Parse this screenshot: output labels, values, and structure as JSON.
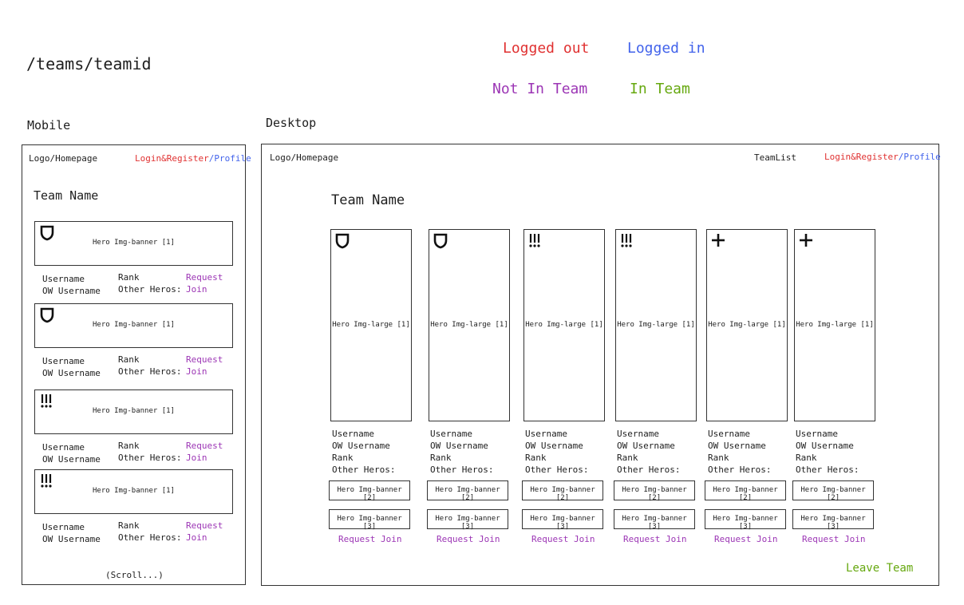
{
  "route": "/teams/teamid",
  "legend": {
    "logged_out": "Logged out",
    "logged_in": "Logged in",
    "not_in_team": "Not In Team",
    "in_team": "In Team"
  },
  "colors": {
    "logged_out": "#e03131",
    "logged_in": "#4263eb",
    "not_in_team": "#9c36b5",
    "in_team": "#66a80f"
  },
  "mobile": {
    "label": "Mobile",
    "logo": "Logo/Homepage",
    "login": "Login&Register",
    "profile": "/Profile",
    "team_name": "Team Name",
    "scroll": "(Scroll...)",
    "members": [
      {
        "icon": "shield-icon",
        "banner": "Hero Img-banner [1]",
        "username": "Username",
        "ow_username": "OW Username",
        "rank": "Rank",
        "other_heroes": "Other Heros:",
        "request": "Request",
        "join": "Join"
      },
      {
        "icon": "shield-icon",
        "banner": "Hero Img-banner [1]",
        "username": "Username",
        "ow_username": "OW Username",
        "rank": "Rank",
        "other_heroes": "Other Heros:",
        "request": "Request",
        "join": "Join"
      },
      {
        "icon": "damage-icon",
        "banner": "Hero Img-banner [1]",
        "username": "Username",
        "ow_username": "OW Username",
        "rank": "Rank",
        "other_heroes": "Other Heros:",
        "request": "Request",
        "join": "Join"
      },
      {
        "icon": "damage-icon",
        "banner": "Hero Img-banner [1]",
        "username": "Username",
        "ow_username": "OW Username",
        "rank": "Rank",
        "other_heroes": "Other Heros:",
        "request": "Request",
        "join": "Join"
      }
    ]
  },
  "desktop": {
    "label": "Desktop",
    "logo": "Logo/Homepage",
    "team_list": "TeamList",
    "login": "Login&Register",
    "profile": "/Profile",
    "team_name": "Team Name",
    "leave_team": "Leave Team",
    "members": [
      {
        "icon": "shield-icon",
        "large": "Hero Img-large [1]",
        "username": "Username",
        "ow_username": "OW Username",
        "rank": "Rank",
        "other_heroes": "Other Heros:",
        "banner2": "Hero Img-banner [2]",
        "banner3": "Hero Img-banner [3]",
        "request_join": "Request Join"
      },
      {
        "icon": "shield-icon",
        "large": "Hero Img-large [1]",
        "username": "Username",
        "ow_username": "OW Username",
        "rank": "Rank",
        "other_heroes": "Other Heros:",
        "banner2": "Hero Img-banner [2]",
        "banner3": "Hero Img-banner [3]",
        "request_join": "Request Join"
      },
      {
        "icon": "damage-icon",
        "large": "Hero Img-large [1]",
        "username": "Username",
        "ow_username": "OW Username",
        "rank": "Rank",
        "other_heroes": "Other Heros:",
        "banner2": "Hero Img-banner [2]",
        "banner3": "Hero Img-banner [3]",
        "request_join": "Request Join"
      },
      {
        "icon": "damage-icon",
        "large": "Hero Img-large [1]",
        "username": "Username",
        "ow_username": "OW Username",
        "rank": "Rank",
        "other_heroes": "Other Heros:",
        "banner2": "Hero Img-banner [2]",
        "banner3": "Hero Img-banner [3]",
        "request_join": "Request Join"
      },
      {
        "icon": "support-icon",
        "large": "Hero Img-large [1]",
        "username": "Username",
        "ow_username": "OW Username",
        "rank": "Rank",
        "other_heroes": "Other Heros:",
        "banner2": "Hero Img-banner [2]",
        "banner3": "Hero Img-banner [3]",
        "request_join": "Request Join"
      },
      {
        "icon": "support-icon",
        "large": "Hero Img-large [1]",
        "username": "Username",
        "ow_username": "OW Username",
        "rank": "Rank",
        "other_heroes": "Other Heros:",
        "banner2": "Hero Img-banner [2]",
        "banner3": "Hero Img-banner [3]",
        "request_join": "Request Join"
      }
    ]
  }
}
